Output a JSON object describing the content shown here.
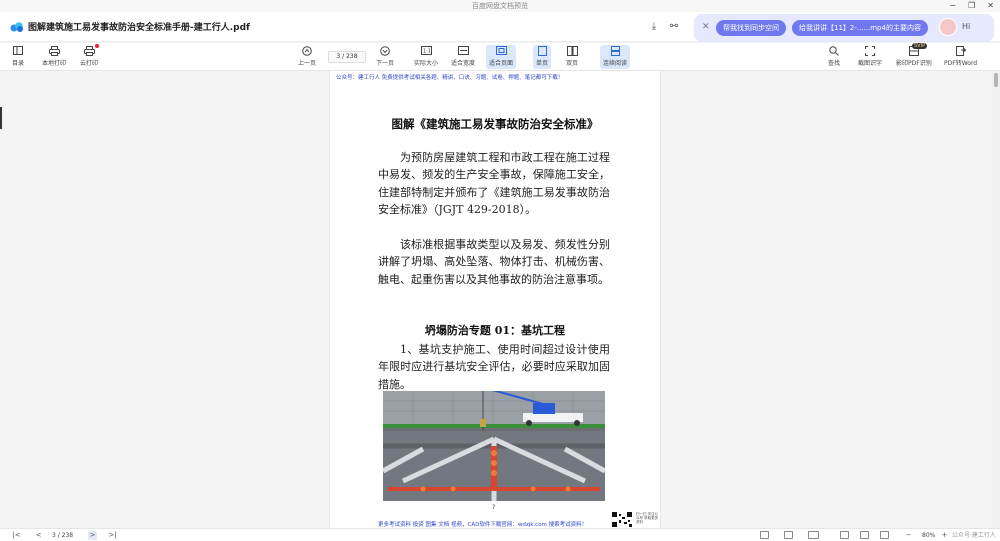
{
  "window": {
    "app_title": "百度网盘文档预览",
    "controls": [
      "−",
      "❐",
      "✕"
    ]
  },
  "header": {
    "file_name": "图解建筑施工易发事故防治安全标准手册-建工行人.pdf"
  },
  "ai_panel": {
    "chip1": "帮我找到同步空间",
    "chip2": "给我讲讲【11】2-......mp4的主要内容",
    "greeting": "Hi"
  },
  "toolbar": {
    "left": [
      {
        "label": "目录",
        "icon": "catalog-icon"
      },
      {
        "label": "本地打印",
        "icon": "printer-icon"
      },
      {
        "label": "云打印",
        "icon": "cloud-print-icon"
      }
    ],
    "prev_page": "上一页",
    "page_input": "3",
    "page_total": "/ 238",
    "next_page": "下一页",
    "actual_size": "实际大小",
    "fit_width": "适合宽度",
    "fit_page": "适合页面",
    "single_page": "单页",
    "double_page": "双页",
    "continuous": "连续阅读",
    "right": [
      {
        "label": "查找",
        "icon": "search-icon"
      },
      {
        "label": "截图识字",
        "icon": "ocr-icon"
      },
      {
        "label": "影印PDF识别",
        "icon": "scan-pdf-icon"
      },
      {
        "label": "PDF转Word",
        "icon": "pdf-to-word-icon"
      }
    ],
    "svip_badge": "SVIP"
  },
  "document": {
    "header_line": "公众号：建工行人 免费提供考试相关各题、精讲、口诀、习题、试卷、押题、笔记都可下载！",
    "title": "图解《建筑施工易发事故防治安全标准》",
    "paragraph1": "为预防房屋建筑工程和市政工程在施工过程中易发、频发的生产安全事故，保障施工安全，住建部特制定并颁布了《建筑施工易发事故防治安全标准》（JGJT 429-2018）。",
    "paragraph2": "该标准根据事故类型以及易发、频发性分别讲解了坍塌、高处坠落、物体打击、机械伤害、触电、起重伤害以及其他事故的防治注意事项。",
    "section_title": "坍塌防治专题 01：基坑工程",
    "paragraph3": "1、基坑支护施工、使用时间超过设计使用年限时应进行基坑安全评估，必要时应采取加固措施。",
    "image_caption": "?",
    "footer_line": "更多考试资料 投资 图集 文档 视频，CAD软件下载官网：wdzjk.com 搜索考试资料！",
    "qr_text": "扫一扫 关注公众号 获取更多资料"
  },
  "statusbar": {
    "first": "|<",
    "prev": "<",
    "page": "3 / 238",
    "next": ">",
    "last": ">|",
    "zoom_out": "−",
    "zoom": "80%",
    "zoom_in": "+",
    "watermark": "公众号·建工行人"
  },
  "colors": {
    "accent": "#6f78ee",
    "toolbar_active": "#dbe7fb",
    "doc_blue": "#2b46c9"
  }
}
